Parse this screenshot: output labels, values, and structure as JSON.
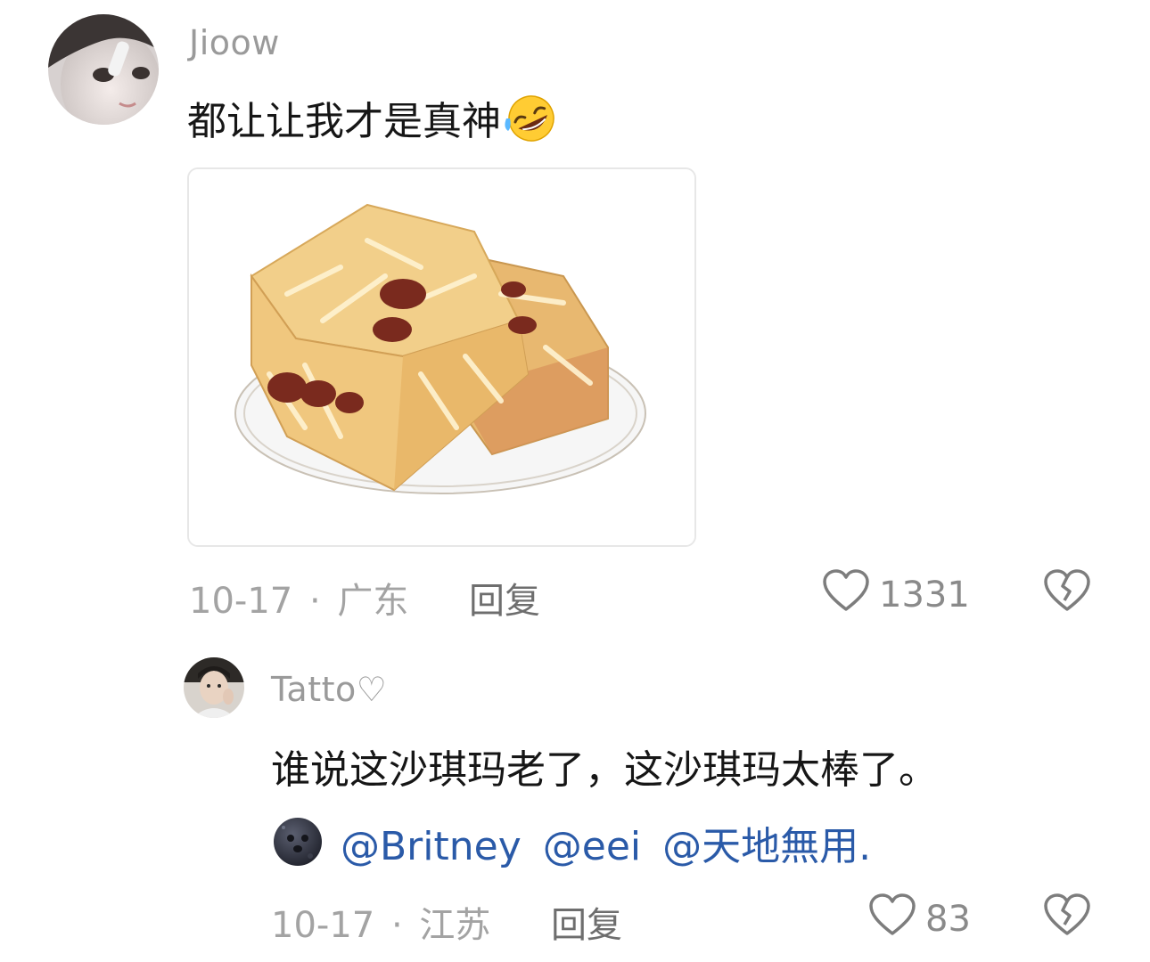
{
  "comment": {
    "username": "Jioow",
    "text": "都让让我才是真神",
    "emoji": "rolling-on-floor-laughing-emoji",
    "image": "sachima-pastry-image",
    "date": "10-17",
    "separator": "·",
    "location": "广东",
    "reply_label": "回复",
    "like_count": "1331"
  },
  "reply": {
    "username": "Tatto♡",
    "text": "谁说这沙琪玛老了，这沙琪玛太棒了。",
    "emoji": "new-moon-face-emoji",
    "mentions": [
      "@Britney",
      "@eei",
      "@天地無用."
    ],
    "date": "10-17",
    "separator": "·",
    "location": "江苏",
    "reply_label": "回复",
    "like_count": "83"
  },
  "colors": {
    "username": "#9a9a9a",
    "body_text": "#161616",
    "mention": "#2a5aa8",
    "meta": "#a3a3a3"
  }
}
